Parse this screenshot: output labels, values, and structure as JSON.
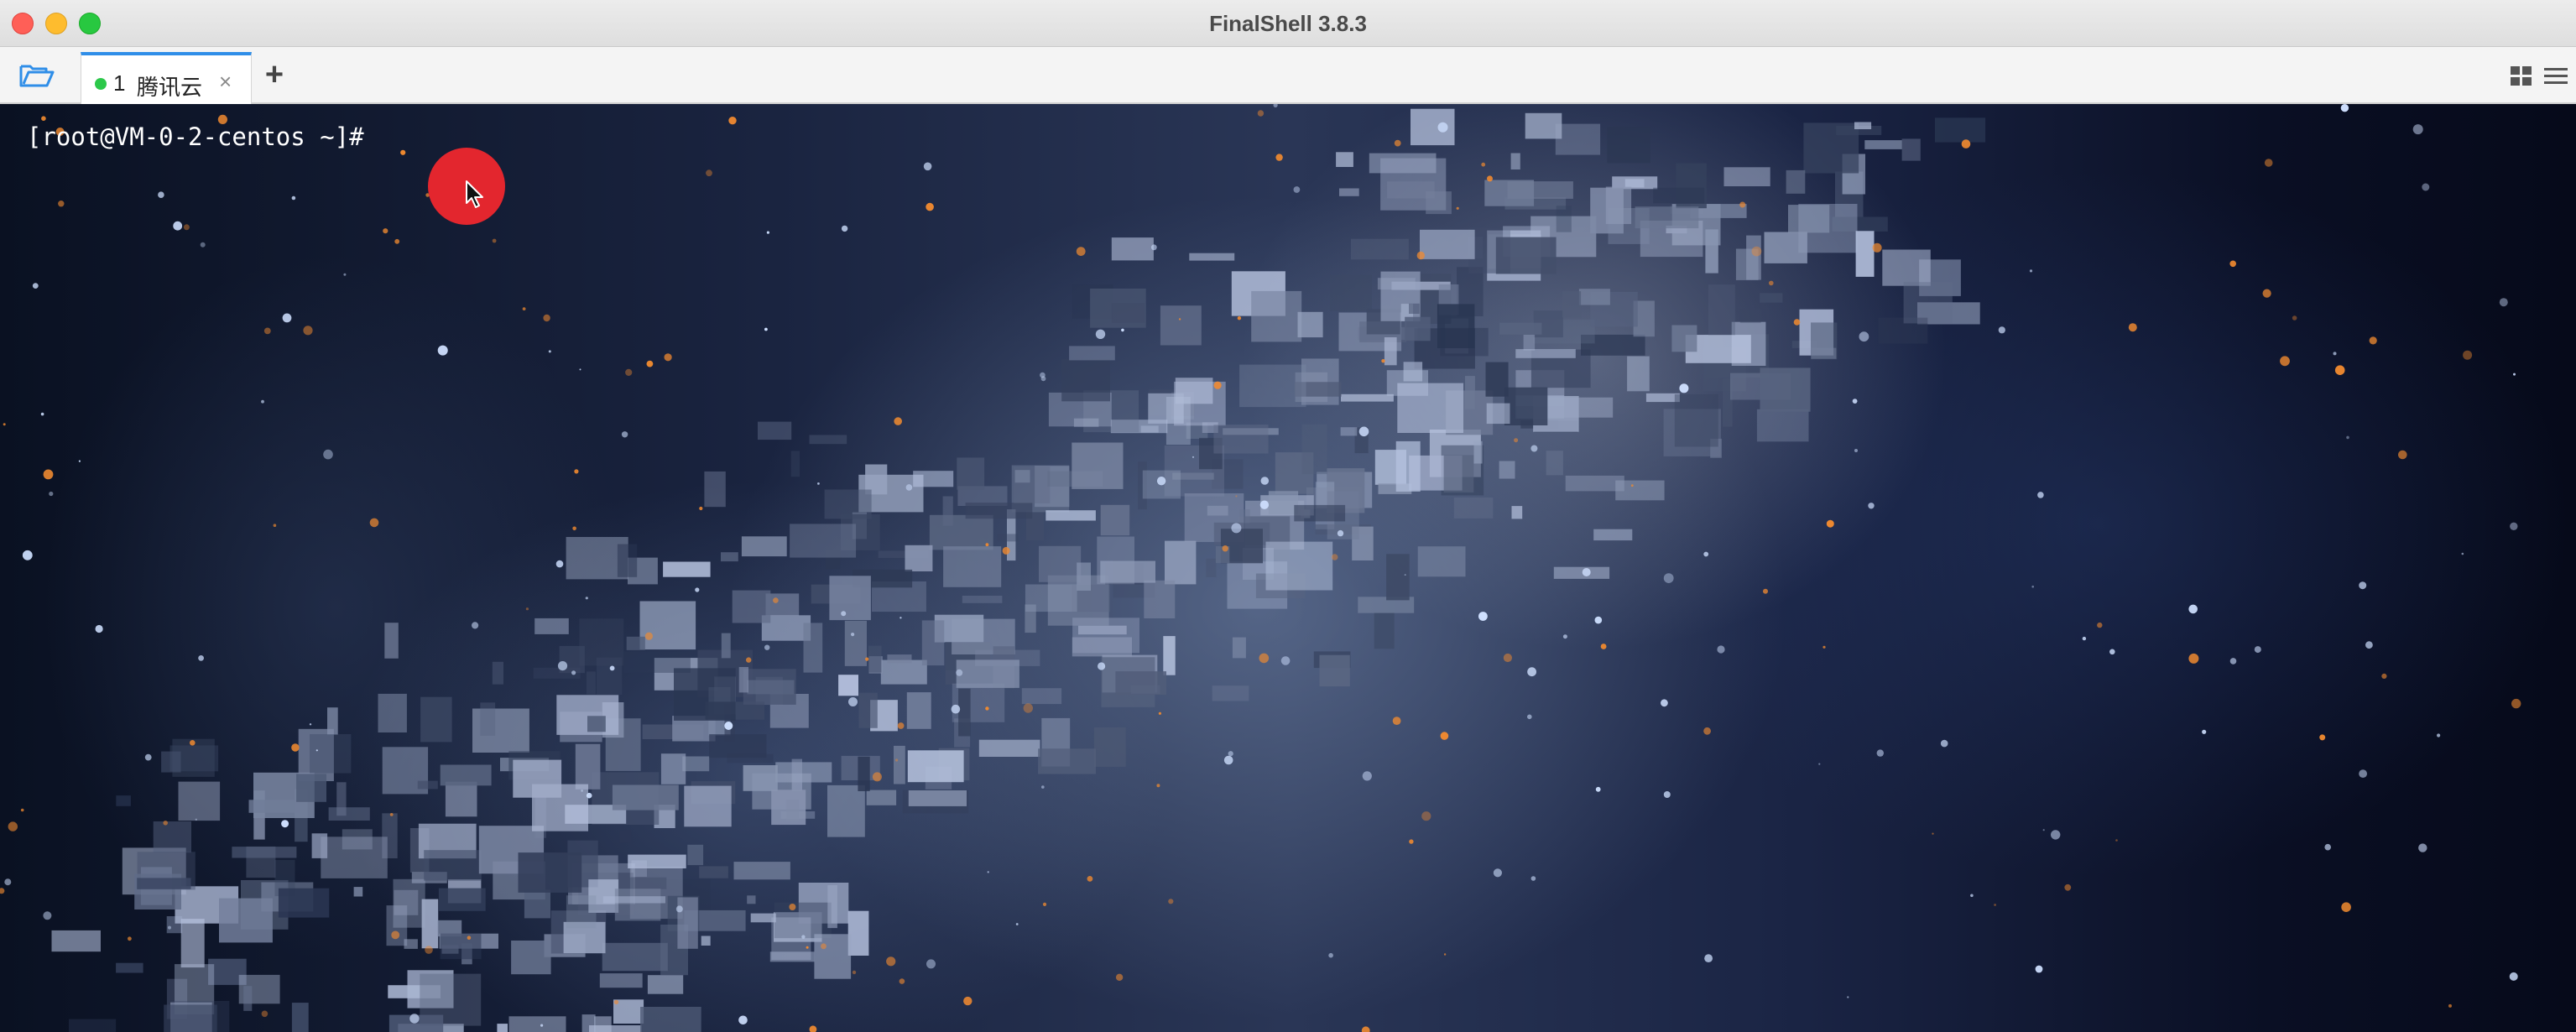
{
  "window": {
    "title": "FinalShell 3.8.3"
  },
  "tabbar": {
    "tabs": [
      {
        "number": "1",
        "label": "腾讯云",
        "status": "connected",
        "status_color": "#2cc84a",
        "close": "×"
      }
    ],
    "add_label": "+",
    "accent": "#2f8ee8"
  },
  "terminal": {
    "prompt": "[root@VM-0-2-centos ~]#"
  },
  "icons": {
    "open": "folder-open-icon",
    "grid": "grid-view-icon",
    "list": "list-view-icon",
    "pointer": "mouse-pointer-icon"
  },
  "colors": {
    "cursor_highlight": "#e3262e"
  }
}
